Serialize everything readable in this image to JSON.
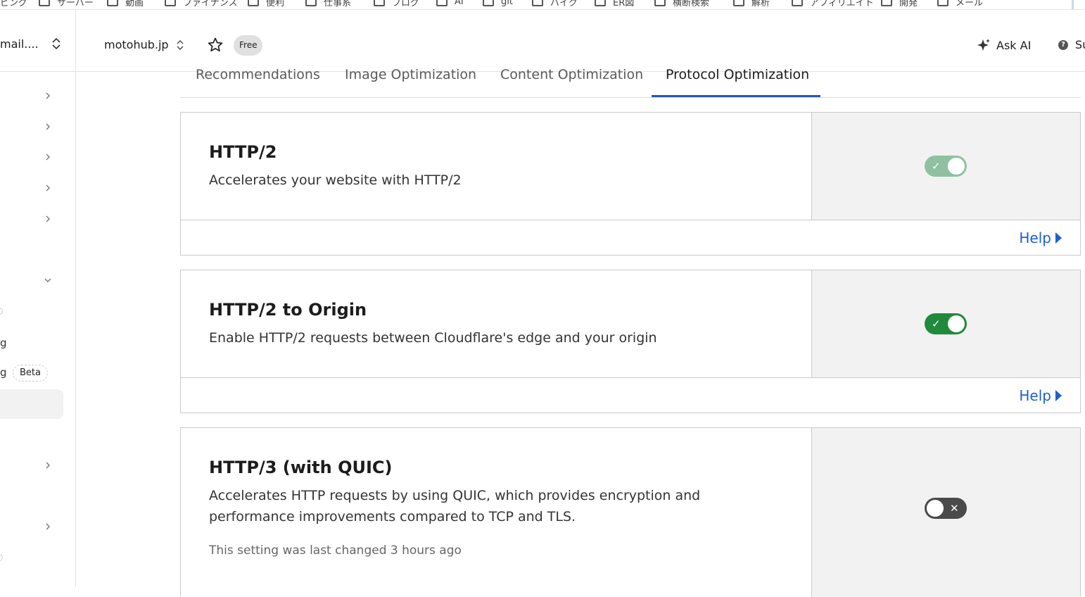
{
  "bookmarks": [
    "ピング",
    "サーバー",
    "動画",
    "ファイナンス",
    "便利",
    "仕事系",
    "ブログ",
    "AI",
    "git",
    "バイク",
    "ER図",
    "横断検索",
    "解析",
    "アフィリエイト",
    "開発",
    "メール"
  ],
  "header": {
    "account": "mail....",
    "domain": "motohub.jp",
    "plan_badge": "Free",
    "ask_ai": "Ask AI",
    "support": "Su"
  },
  "sidebar": {
    "fragment_1": "g",
    "fragment_2": "g",
    "beta_badge": "Beta"
  },
  "tabs": [
    "Recommendations",
    "Image Optimization",
    "Content Optimization",
    "Protocol Optimization"
  ],
  "active_tab": "Protocol Optimization",
  "cards": [
    {
      "title": "HTTP/2",
      "description": "Accelerates your website with HTTP/2",
      "toggle_state": "on",
      "toggle_color": "#8fc1a0",
      "help": "Help"
    },
    {
      "title": "HTTP/2 to Origin",
      "description": "Enable HTTP/2 requests between Cloudflare's edge and your origin",
      "toggle_state": "on",
      "toggle_color": "#1f8a3b",
      "help": "Help"
    },
    {
      "title": "HTTP/3 (with QUIC)",
      "description": "Accelerates HTTP requests by using QUIC, which provides encryption and performance improvements compared to TCP and TLS.",
      "note": "This setting was last changed 3 hours ago",
      "toggle_state": "off",
      "toggle_color": "#4a4a4a"
    }
  ],
  "colors": {
    "accent": "#2357c8",
    "link": "#1f5fcf"
  }
}
